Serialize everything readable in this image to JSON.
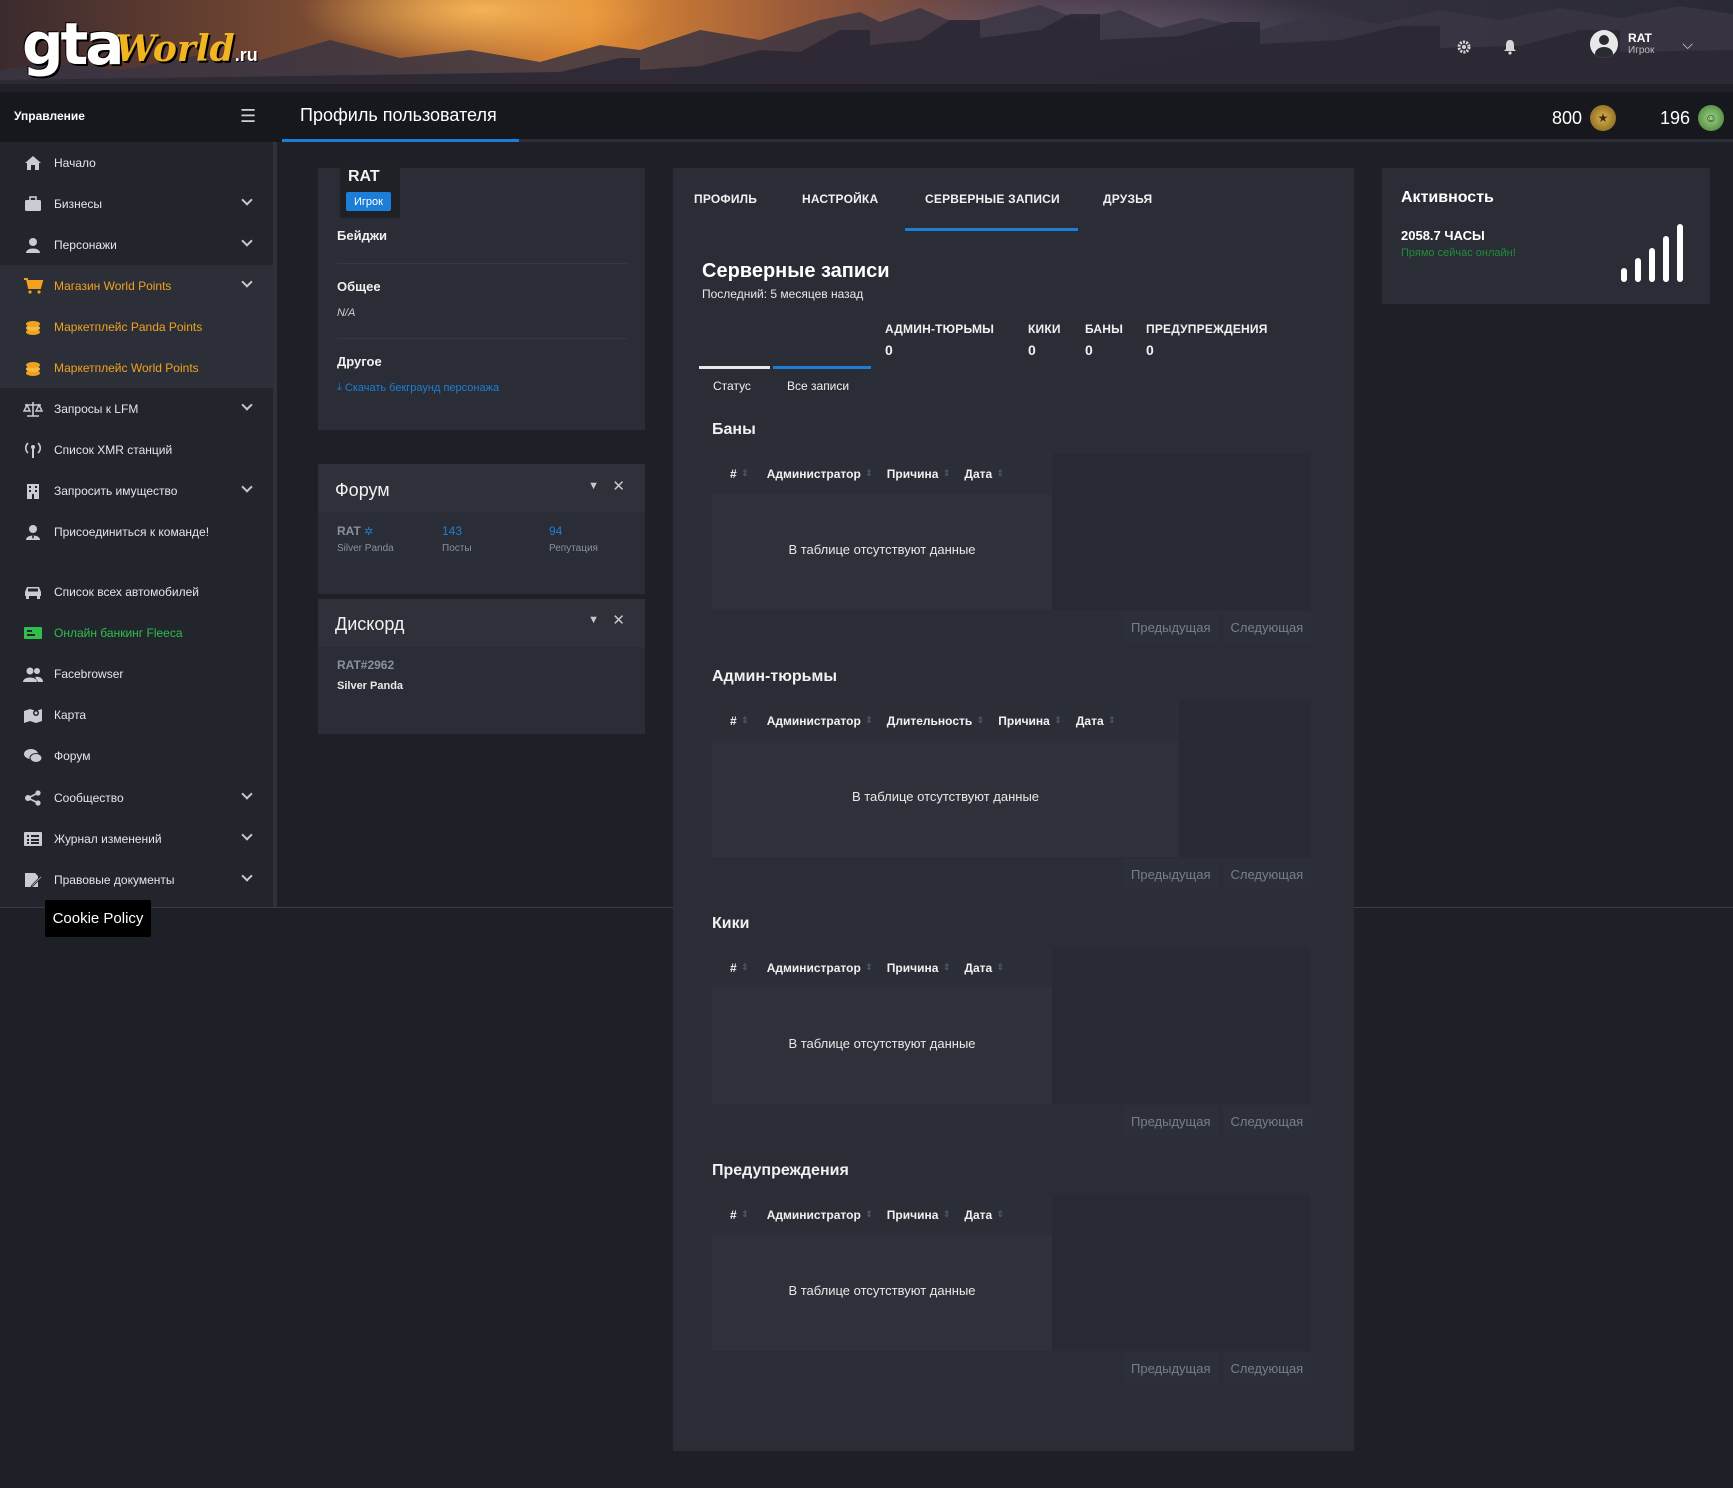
{
  "header": {
    "logo": {
      "gta": "gta",
      "world": "World",
      "ru": ".ru"
    },
    "user": {
      "name": "RAT",
      "role": "Игрок"
    },
    "icons": [
      "gear-icon",
      "bell-icon"
    ]
  },
  "topbar": {
    "management": "Управление",
    "page_title": "Профиль пользователя",
    "world_points": "800",
    "panda_points": "196"
  },
  "sidebar": {
    "items": [
      {
        "label": "Начало",
        "icon": "home-icon"
      },
      {
        "label": "Бизнесы",
        "icon": "briefcase-icon"
      },
      {
        "label": "Персонажи",
        "icon": "person-icon"
      },
      {
        "label": "Магазин World Points",
        "icon": "cart-icon"
      },
      {
        "label": "Маркетплейс Panda Points",
        "icon": "coins-icon"
      },
      {
        "label": "Маркетплейс World Points",
        "icon": "coins-icon"
      },
      {
        "label": "Запросы к LFM",
        "icon": "scales-icon"
      },
      {
        "label": "Список XMR станций",
        "icon": "antenna-icon"
      },
      {
        "label": "Запросить имущество",
        "icon": "building-icon"
      },
      {
        "label": "Присоединиться к команде!",
        "icon": "user-tie-icon"
      },
      {
        "label": "Список всех автомобилей",
        "icon": "car-icon"
      },
      {
        "label": "Онлайн банкинг Fleeca",
        "icon": "money-icon"
      },
      {
        "label": "Facebrowser",
        "icon": "users-icon"
      },
      {
        "label": "Карта",
        "icon": "map-icon"
      },
      {
        "label": "Форум",
        "icon": "comments-icon"
      },
      {
        "label": "Сообщество",
        "icon": "share-icon"
      },
      {
        "label": "Журнал изменений",
        "icon": "list-icon"
      },
      {
        "label": "Правовые документы",
        "icon": "document-icon"
      }
    ]
  },
  "cookie": {
    "label": "Cookie Policy"
  },
  "profile_card": {
    "name": "RAT",
    "role_badge": "Игрок",
    "badges_label": "Бейджи",
    "general_label": "Общее",
    "general_value": "N/A",
    "other_label": "Другое",
    "download_link": "Скачать бекграунд персонажа"
  },
  "forum_card": {
    "title": "Форум",
    "user": "RAT",
    "user_rank": "Silver Panda",
    "posts_value": "143",
    "posts_label": "Посты",
    "rep_value": "94",
    "rep_label": "Репутация"
  },
  "discord_card": {
    "title": "Дискорд",
    "tag": "RAT#2962",
    "rank": "Silver Panda"
  },
  "main": {
    "tabs": [
      "ПРОФИЛЬ",
      "НАСТРОЙКА",
      "СЕРВЕРНЫЕ ЗАПИСИ",
      "ДРУЗЬЯ"
    ],
    "title": "Серверные записи",
    "subtitle": "Последний: 5 месяцев назад",
    "stats": [
      {
        "label": "АДМИН-ТЮРЬМЫ",
        "value": "0"
      },
      {
        "label": "КИКИ",
        "value": "0"
      },
      {
        "label": "БАНЫ",
        "value": "0"
      },
      {
        "label": "ПРЕДУПРЕЖДЕНИЯ",
        "value": "0"
      }
    ],
    "subtabs": [
      "Статус",
      "Все записи"
    ],
    "no_data": "В таблице отсутствуют данные",
    "prev": "Предыдущая",
    "next": "Следующая",
    "sections": [
      {
        "title": "Баны",
        "columns": [
          "#",
          "Администратор",
          "Причина",
          "Дата"
        ]
      },
      {
        "title": "Админ-тюрьмы",
        "columns": [
          "#",
          "Администратор",
          "Длительность",
          "Причина",
          "Дата"
        ]
      },
      {
        "title": "Кики",
        "columns": [
          "#",
          "Администратор",
          "Причина",
          "Дата"
        ]
      },
      {
        "title": "Предупреждения",
        "columns": [
          "#",
          "Администратор",
          "Причина",
          "Дата"
        ]
      }
    ]
  },
  "activity": {
    "title": "Активность",
    "hours": "2058.7 ЧАСЫ",
    "status": "Прямо сейчас онлайн!"
  },
  "colors": {
    "accent": "#1c7ed6",
    "orange": "#f0a21f",
    "green": "#2fbf4a"
  }
}
